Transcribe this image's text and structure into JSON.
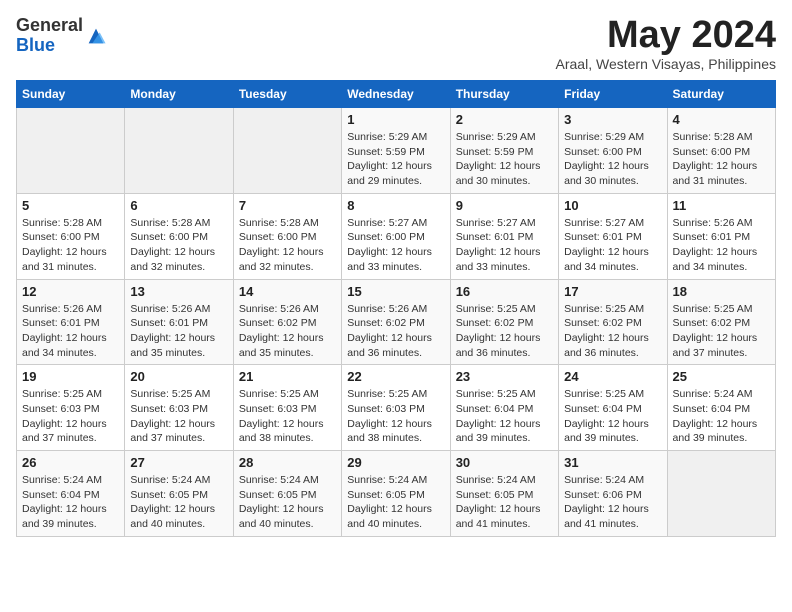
{
  "header": {
    "logo_general": "General",
    "logo_blue": "Blue",
    "month": "May 2024",
    "location": "Araal, Western Visayas, Philippines"
  },
  "days_of_week": [
    "Sunday",
    "Monday",
    "Tuesday",
    "Wednesday",
    "Thursday",
    "Friday",
    "Saturday"
  ],
  "weeks": [
    [
      {
        "day": "",
        "detail": ""
      },
      {
        "day": "",
        "detail": ""
      },
      {
        "day": "",
        "detail": ""
      },
      {
        "day": "1",
        "detail": "Sunrise: 5:29 AM\nSunset: 5:59 PM\nDaylight: 12 hours and 29 minutes."
      },
      {
        "day": "2",
        "detail": "Sunrise: 5:29 AM\nSunset: 5:59 PM\nDaylight: 12 hours and 30 minutes."
      },
      {
        "day": "3",
        "detail": "Sunrise: 5:29 AM\nSunset: 6:00 PM\nDaylight: 12 hours and 30 minutes."
      },
      {
        "day": "4",
        "detail": "Sunrise: 5:28 AM\nSunset: 6:00 PM\nDaylight: 12 hours and 31 minutes."
      }
    ],
    [
      {
        "day": "5",
        "detail": "Sunrise: 5:28 AM\nSunset: 6:00 PM\nDaylight: 12 hours and 31 minutes."
      },
      {
        "day": "6",
        "detail": "Sunrise: 5:28 AM\nSunset: 6:00 PM\nDaylight: 12 hours and 32 minutes."
      },
      {
        "day": "7",
        "detail": "Sunrise: 5:28 AM\nSunset: 6:00 PM\nDaylight: 12 hours and 32 minutes."
      },
      {
        "day": "8",
        "detail": "Sunrise: 5:27 AM\nSunset: 6:00 PM\nDaylight: 12 hours and 33 minutes."
      },
      {
        "day": "9",
        "detail": "Sunrise: 5:27 AM\nSunset: 6:01 PM\nDaylight: 12 hours and 33 minutes."
      },
      {
        "day": "10",
        "detail": "Sunrise: 5:27 AM\nSunset: 6:01 PM\nDaylight: 12 hours and 34 minutes."
      },
      {
        "day": "11",
        "detail": "Sunrise: 5:26 AM\nSunset: 6:01 PM\nDaylight: 12 hours and 34 minutes."
      }
    ],
    [
      {
        "day": "12",
        "detail": "Sunrise: 5:26 AM\nSunset: 6:01 PM\nDaylight: 12 hours and 34 minutes."
      },
      {
        "day": "13",
        "detail": "Sunrise: 5:26 AM\nSunset: 6:01 PM\nDaylight: 12 hours and 35 minutes."
      },
      {
        "day": "14",
        "detail": "Sunrise: 5:26 AM\nSunset: 6:02 PM\nDaylight: 12 hours and 35 minutes."
      },
      {
        "day": "15",
        "detail": "Sunrise: 5:26 AM\nSunset: 6:02 PM\nDaylight: 12 hours and 36 minutes."
      },
      {
        "day": "16",
        "detail": "Sunrise: 5:25 AM\nSunset: 6:02 PM\nDaylight: 12 hours and 36 minutes."
      },
      {
        "day": "17",
        "detail": "Sunrise: 5:25 AM\nSunset: 6:02 PM\nDaylight: 12 hours and 36 minutes."
      },
      {
        "day": "18",
        "detail": "Sunrise: 5:25 AM\nSunset: 6:02 PM\nDaylight: 12 hours and 37 minutes."
      }
    ],
    [
      {
        "day": "19",
        "detail": "Sunrise: 5:25 AM\nSunset: 6:03 PM\nDaylight: 12 hours and 37 minutes."
      },
      {
        "day": "20",
        "detail": "Sunrise: 5:25 AM\nSunset: 6:03 PM\nDaylight: 12 hours and 37 minutes."
      },
      {
        "day": "21",
        "detail": "Sunrise: 5:25 AM\nSunset: 6:03 PM\nDaylight: 12 hours and 38 minutes."
      },
      {
        "day": "22",
        "detail": "Sunrise: 5:25 AM\nSunset: 6:03 PM\nDaylight: 12 hours and 38 minutes."
      },
      {
        "day": "23",
        "detail": "Sunrise: 5:25 AM\nSunset: 6:04 PM\nDaylight: 12 hours and 39 minutes."
      },
      {
        "day": "24",
        "detail": "Sunrise: 5:25 AM\nSunset: 6:04 PM\nDaylight: 12 hours and 39 minutes."
      },
      {
        "day": "25",
        "detail": "Sunrise: 5:24 AM\nSunset: 6:04 PM\nDaylight: 12 hours and 39 minutes."
      }
    ],
    [
      {
        "day": "26",
        "detail": "Sunrise: 5:24 AM\nSunset: 6:04 PM\nDaylight: 12 hours and 39 minutes."
      },
      {
        "day": "27",
        "detail": "Sunrise: 5:24 AM\nSunset: 6:05 PM\nDaylight: 12 hours and 40 minutes."
      },
      {
        "day": "28",
        "detail": "Sunrise: 5:24 AM\nSunset: 6:05 PM\nDaylight: 12 hours and 40 minutes."
      },
      {
        "day": "29",
        "detail": "Sunrise: 5:24 AM\nSunset: 6:05 PM\nDaylight: 12 hours and 40 minutes."
      },
      {
        "day": "30",
        "detail": "Sunrise: 5:24 AM\nSunset: 6:05 PM\nDaylight: 12 hours and 41 minutes."
      },
      {
        "day": "31",
        "detail": "Sunrise: 5:24 AM\nSunset: 6:06 PM\nDaylight: 12 hours and 41 minutes."
      },
      {
        "day": "",
        "detail": ""
      }
    ]
  ]
}
